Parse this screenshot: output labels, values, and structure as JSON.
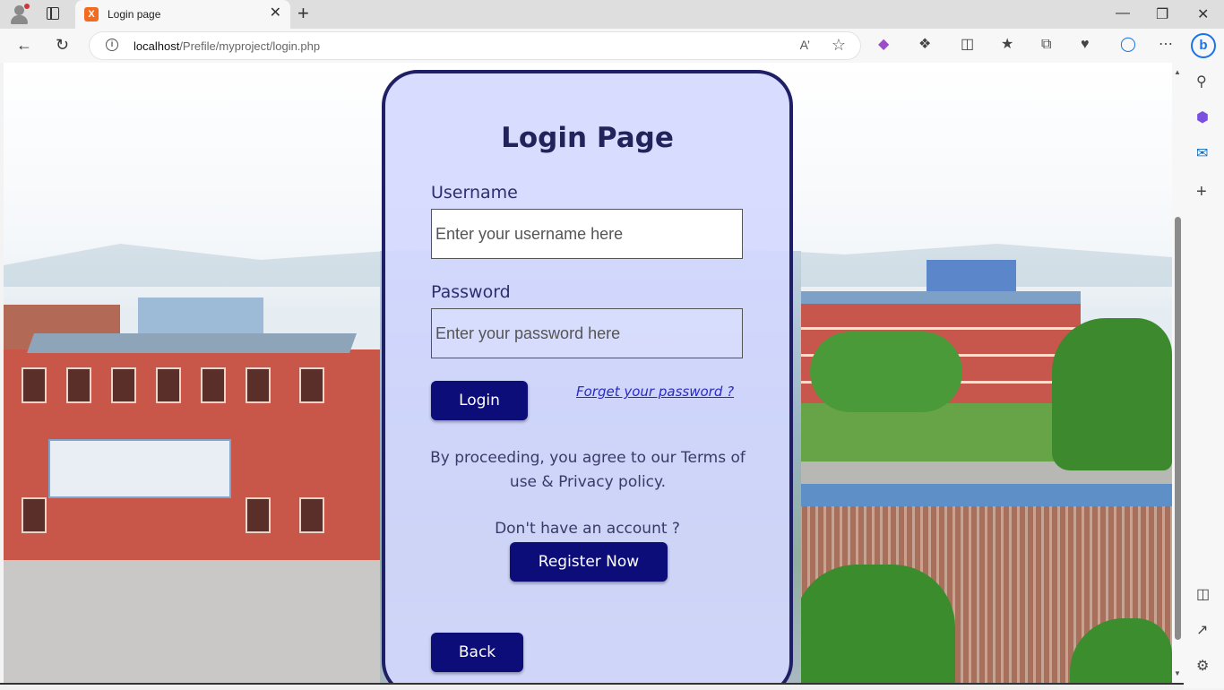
{
  "browser": {
    "tab_title": "Login page",
    "tab_close": "✕",
    "new_tab": "+",
    "url_host": "localhost",
    "url_path": "/Prefile/myproject/login.php",
    "read_aloud": "A’",
    "window": {
      "minimize": "—",
      "restore": "❐",
      "close": "✕"
    }
  },
  "login": {
    "heading": "Login Page",
    "username_label": "Username",
    "username_placeholder": "Enter your username here",
    "password_label": "Password",
    "password_placeholder": "Enter your password here",
    "login_button": "Login",
    "forget_link": "Forget your password ?",
    "terms_text": "By proceeding, you agree to our Terms of use & Privacy policy.",
    "no_account_text": "Don't have an account ?",
    "register_button": "Register Now",
    "back_button": "Back"
  },
  "colors": {
    "card_border": "#1f1f66",
    "card_bg": "#d4d8ff",
    "button_bg": "#0d0d7a",
    "heading": "#23235c",
    "link": "#2a2ac4"
  },
  "icons": {
    "back": "back-arrow-icon",
    "refresh": "refresh-icon",
    "info": "info-icon",
    "favorite": "star-icon",
    "extensions": "puzzle-icon",
    "split": "split-screen-icon",
    "favorites": "favorites-icon",
    "collections": "collections-icon",
    "health": "browser-essentials-icon",
    "copilot": "copilot-icon",
    "more": "more-icon",
    "bing": "bing-icon",
    "search": "search-icon",
    "add": "plus-icon",
    "settings": "gear-icon"
  }
}
